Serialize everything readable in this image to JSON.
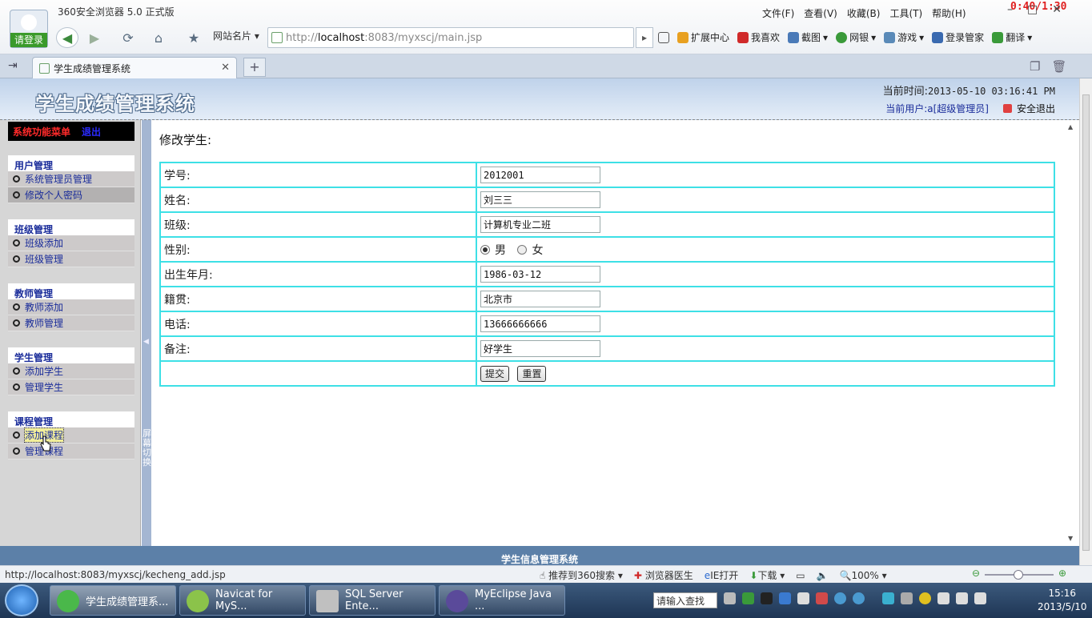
{
  "browser": {
    "title": "360安全浏览器 5.0 正式版",
    "login_label": "请登录",
    "timer": "0:40/1:30",
    "menu": [
      "文件(F)",
      "查看(V)",
      "收藏(B)",
      "工具(T)",
      "帮助(H)"
    ],
    "site_card_label": "网站名片",
    "address_prefix": "http://",
    "address_host": "localhost",
    "address_rest": ":8083/myxscj/main.jsp",
    "toolbar": [
      "扩展中心",
      "我喜欢",
      "截图",
      "网银",
      "游戏",
      "登录管家",
      "翻译"
    ],
    "tab_title": "学生成绩管理系统"
  },
  "header": {
    "site_title": "学生成绩管理系统",
    "time_label": "当前时间:",
    "time_value": "2013-05-10 03:16:41 PM",
    "user_label": "当前用户:a[超级管理员]",
    "logout_label": "安全退出"
  },
  "menu": {
    "top_title": "系统功能菜单",
    "top_exit": "退出",
    "splitter_label": "屏幕切换",
    "groups": [
      {
        "title": "用户管理",
        "items": [
          "系统管理员管理",
          "修改个人密码"
        ]
      },
      {
        "title": "班级管理",
        "items": [
          "班级添加",
          "班级管理"
        ]
      },
      {
        "title": "教师管理",
        "items": [
          "教师添加",
          "教师管理"
        ]
      },
      {
        "title": "学生管理",
        "items": [
          "添加学生",
          "管理学生"
        ]
      },
      {
        "title": "课程管理",
        "items": [
          "添加课程",
          "管理课程"
        ]
      }
    ]
  },
  "form": {
    "title": "修改学生:",
    "fields": {
      "student_id": {
        "label": "学号:",
        "value": "2012001"
      },
      "name": {
        "label": "姓名:",
        "value": "刘三三"
      },
      "class": {
        "label": "班级:",
        "value": "计算机专业二班"
      },
      "gender": {
        "label": "性别:",
        "option_male": "男",
        "option_female": "女",
        "selected": "男"
      },
      "birth": {
        "label": "出生年月:",
        "value": "1986-03-12"
      },
      "hometown": {
        "label": "籍贯:",
        "value": "北京市"
      },
      "phone": {
        "label": "电话:",
        "value": "13666666666"
      },
      "remark": {
        "label": "备注:",
        "value": "好学生"
      }
    },
    "submit_label": "提交",
    "reset_label": "重置"
  },
  "footer": {
    "text": "学生信息管理系统"
  },
  "statusbar": {
    "url": "http://localhost:8083/myxscj/kecheng_add.jsp",
    "items": [
      "推荐到360搜索",
      "浏览器医生",
      "IE打开",
      "下载"
    ],
    "zoom": "100%"
  },
  "taskbar": {
    "tasks": [
      "学生成绩管理系...",
      "Navicat for MyS...",
      "SQL Server Ente...",
      "MyEclipse Java ..."
    ],
    "search_placeholder": "请输入查找",
    "time": "15:16",
    "date": "2013/5/10"
  },
  "colors": {
    "form_border": "#3ee0e6",
    "menu_link": "#1a2c9a",
    "header_gradient_top": "#bfd2ea",
    "footer_bg": "#5c80a8",
    "timer_red": "#e02020"
  }
}
